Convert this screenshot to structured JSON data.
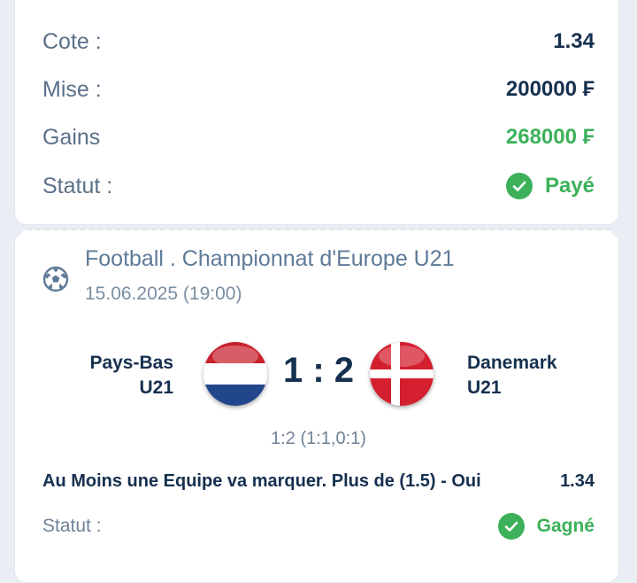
{
  "summary": {
    "cote_label": "Cote :",
    "cote_value": "1.34",
    "mise_label": "Mise :",
    "mise_value": "200000 ₣",
    "gains_label": "Gains",
    "gains_value": "268000 ₣",
    "statut_label": "Statut :",
    "statut_value": "Payé"
  },
  "event": {
    "league": "Football . Championnat d'Europe U21",
    "date": "15.06.2025 (19:00)",
    "home_line1": "Pays-Bas",
    "home_line2": "U21",
    "away_line1": "Danemark",
    "away_line2": "U21",
    "score": "1 : 2",
    "score_detail": "1:2 (1:1,0:1)",
    "market": "Au Moins une Equipe va marquer. Plus de (1.5) - Oui",
    "market_odd": "1.34",
    "statut_label": "Statut :",
    "statut_value": "Gagné"
  },
  "icons": {
    "ball": "soccer-ball-icon",
    "check": "check-circle-icon",
    "home_flag": "netherlands-flag-icon",
    "away_flag": "denmark-flag-icon"
  },
  "colors": {
    "accent_green": "#3cb15a",
    "dark_text": "#16304f",
    "muted_text": "#5b7189"
  }
}
